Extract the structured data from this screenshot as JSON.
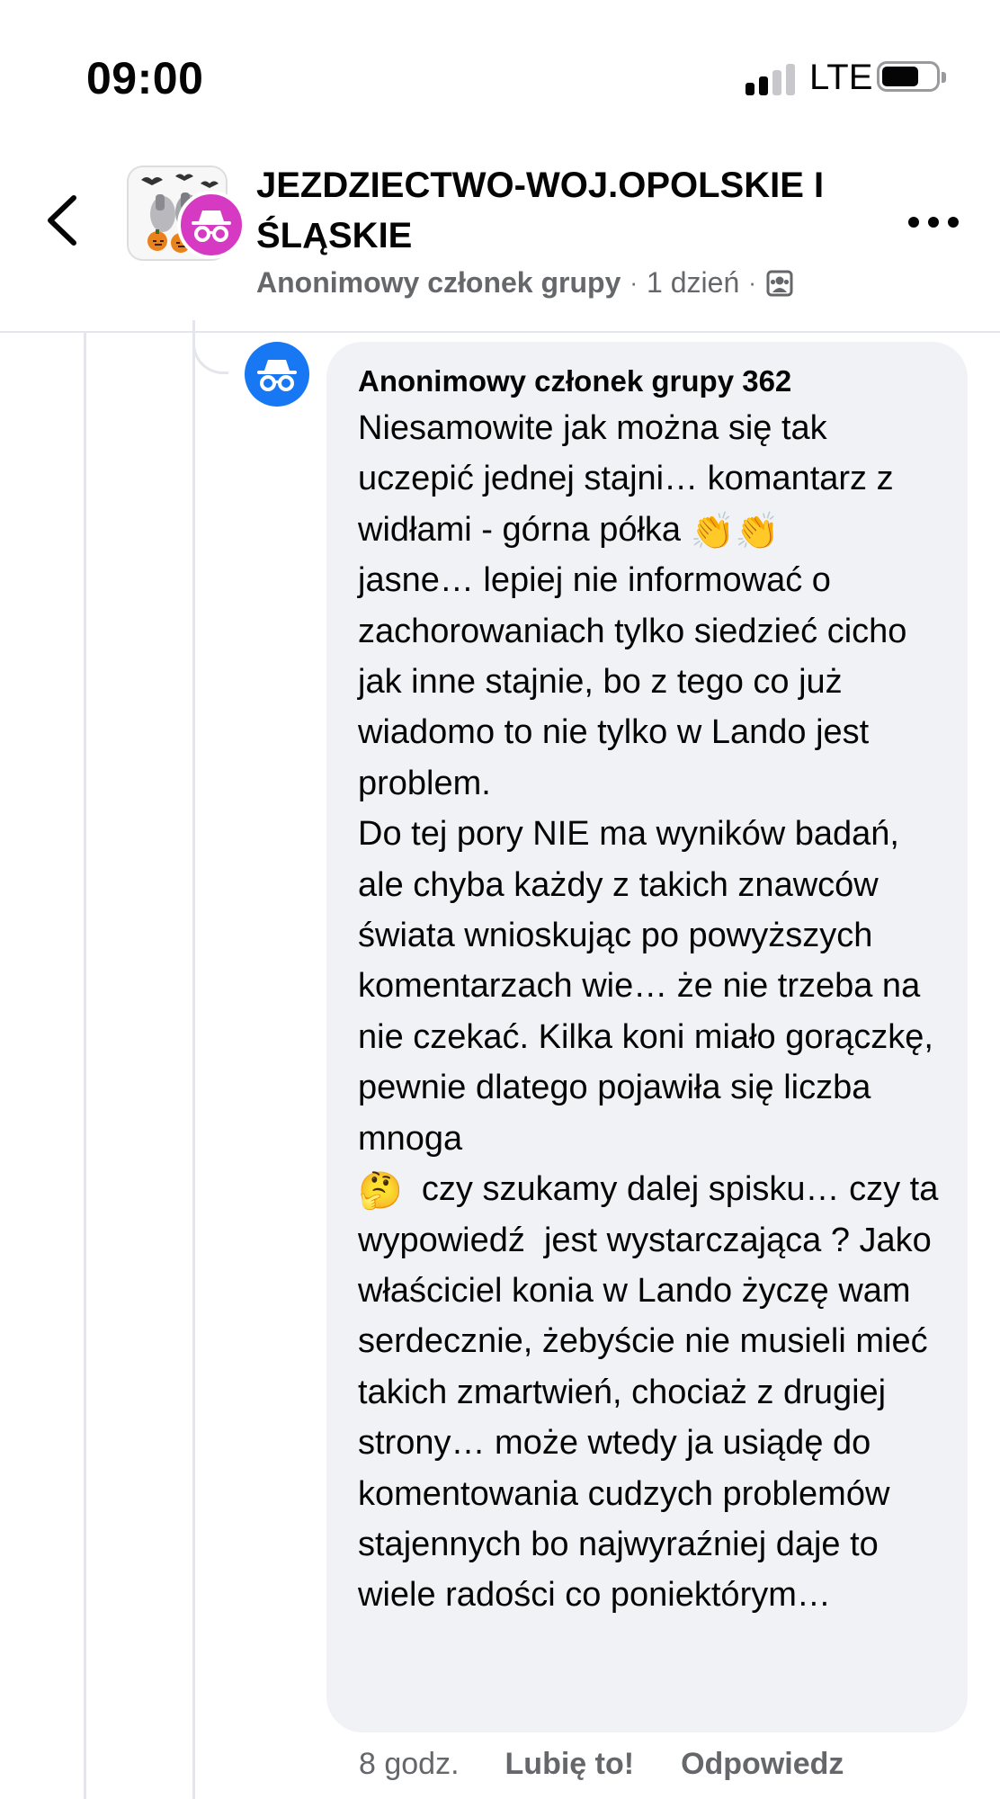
{
  "status_bar": {
    "time": "09:00",
    "network": "LTE",
    "icons": [
      "cellular-signal-icon",
      "battery-icon"
    ]
  },
  "header": {
    "group_title": "JEZDZIECTWO-WOJ.OPOLSKIE I ŚLĄSKIE",
    "post_author": "Anonimowy członek grupy",
    "separator": "·",
    "post_time": "1 dzień",
    "icons": [
      "back-chevron-icon",
      "incognito-icon",
      "group-audience-icon",
      "more-options-icon"
    ]
  },
  "comment": {
    "author": "Anonimowy członek grupy 362",
    "part1": "Niesamowite jak można się tak uczepić jednej stajni… komantarz z widłami - górna półka ",
    "emoji_clap": "👏",
    "part2": "\njasne… lepiej nie informować o zachorowaniach tylko siedzieć cicho jak inne stajnie, bo z tego co już wiadomo to nie tylko w Lando jest problem.\nDo tej pory NIE ma wyników badań, ale chyba każdy z takich znawców świata wnioskując po powyższych komentarzach wie… że nie trzeba na nie czekać. Kilka koni miało gorączkę, pewnie dlatego pojawiła się liczba mnoga\n",
    "emoji_thinking": "🤔",
    "part3": "  czy szukamy dalej spisku… czy ta wypowiedź  jest wystarczająca ? Jako właściciel konia w Lando życzę wam serdecznie, żebyście nie musieli mieć takich zmartwień, chociaż z drugiej strony… może wtedy ja usiądę do komentowania cudzych problemów stajennych bo najwyraźniej daje to wiele radości co poniektórym…",
    "time_ago": "8 godz.",
    "like_label": "Lubię to!",
    "reply_label": "Odpowiedz"
  },
  "colors": {
    "anon_badge": "#d63ac2",
    "comment_avatar": "#1877f2",
    "bubble": "#f0f2f5",
    "secondary_text": "#65676b"
  }
}
